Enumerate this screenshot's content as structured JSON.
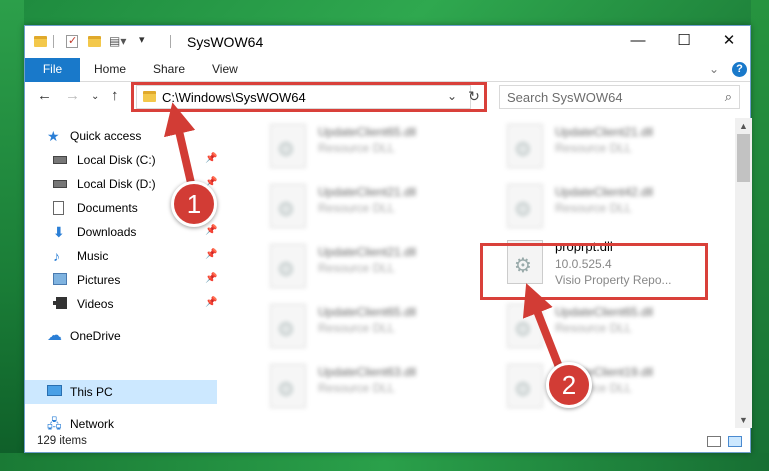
{
  "window": {
    "title": "SysWOW64",
    "controls": {
      "minimize": "—",
      "maximize": "☐",
      "close": "✕"
    }
  },
  "ribbon": {
    "tabs": [
      "File",
      "Home",
      "Share",
      "View"
    ],
    "help_label": "?"
  },
  "address_bar": {
    "path": "C:\\Windows\\SysWOW64"
  },
  "search": {
    "placeholder": "Search SysWOW64"
  },
  "nav_pane": {
    "items": [
      {
        "label": "Quick access",
        "icon": "star-icon"
      },
      {
        "label": "Local Disk (C:)",
        "icon": "drive-icon",
        "pinned": true
      },
      {
        "label": "Local Disk (D:)",
        "icon": "drive-icon",
        "pinned": true
      },
      {
        "label": "Documents",
        "icon": "documents-icon",
        "pinned": true
      },
      {
        "label": "Downloads",
        "icon": "downloads-icon",
        "pinned": true
      },
      {
        "label": "Music",
        "icon": "music-icon",
        "pinned": true
      },
      {
        "label": "Pictures",
        "icon": "pictures-icon",
        "pinned": true
      },
      {
        "label": "Videos",
        "icon": "videos-icon",
        "pinned": true
      },
      {
        "label": "OneDrive",
        "icon": "cloud-icon"
      },
      {
        "label": "This PC",
        "icon": "computer-icon",
        "selected": true
      },
      {
        "label": "Network",
        "icon": "network-icon"
      }
    ]
  },
  "files": [
    {
      "name": "UpdateClient65.dll",
      "type": "Resource DLL",
      "blurred": true
    },
    {
      "name": "UpdateClient21.dll",
      "type": "Resource DLL",
      "blurred": true
    },
    {
      "name": "UpdateClient21.dll",
      "type": "Resource DLL",
      "blurred": true
    },
    {
      "name": "UpdateClient42.dll",
      "type": "Resource DLL",
      "blurred": true
    },
    {
      "name": "UpdateClient21.dll",
      "type": "Resource DLL",
      "blurred": true
    },
    {
      "name": "proprpt.dll",
      "version": "10.0.525.4",
      "description": "Visio Property Repo...",
      "blurred": false
    },
    {
      "name": "UpdateClient65.dll",
      "type": "Resource DLL",
      "blurred": true
    },
    {
      "name": "UpdateClient65.dll",
      "type": "Resource DLL",
      "blurred": true
    },
    {
      "name": "UpdateClient63.dll",
      "type": "Resource DLL",
      "blurred": true
    },
    {
      "name": "UpdateClient19.dll",
      "type": "Resource DLL",
      "blurred": true
    }
  ],
  "status_bar": {
    "item_count": "129 items"
  },
  "annotations": {
    "step1": "1",
    "step2": "2",
    "color": "#d23c35"
  }
}
